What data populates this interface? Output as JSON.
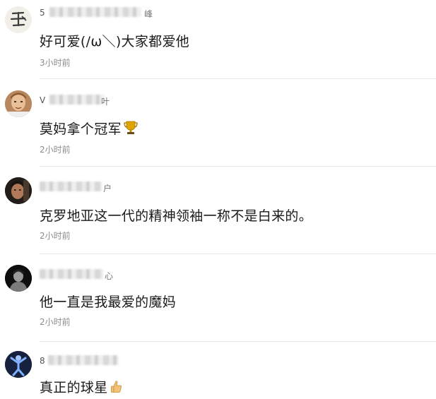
{
  "comments": [
    {
      "username_first": "5",
      "username_last": "峰",
      "text": "好可爱(/ω＼)大家都爱他",
      "time": "3小时前",
      "avatar_glyph": "王",
      "avatar_icon": "handwritten-character-avatar"
    },
    {
      "username_first": "V",
      "username_last": "叶",
      "text": "莫妈拿个冠军",
      "time": "2小时前",
      "avatar_icon": "player-photo-avatar",
      "emoji": "trophy-icon"
    },
    {
      "username_first": "",
      "username_last": "户",
      "text": "克罗地亚这一代的精神领袖一称不是白来的。",
      "time": "2小时前",
      "avatar_icon": "dark-photo-avatar"
    },
    {
      "username_first": "",
      "username_last": "心",
      "text": "他一直是我最爱的魔妈",
      "time": "2小时前",
      "avatar_icon": "bw-portrait-avatar"
    },
    {
      "username_first": "8",
      "username_last": "",
      "text": "真正的球星",
      "time": "",
      "avatar_icon": "blue-figure-avatar",
      "emoji": "thumbs-up-icon"
    }
  ],
  "colors": {
    "text": "#1a1a1a",
    "meta": "#8c8c8c",
    "divider": "#e8e8e8",
    "trophy": "#e0a400"
  }
}
